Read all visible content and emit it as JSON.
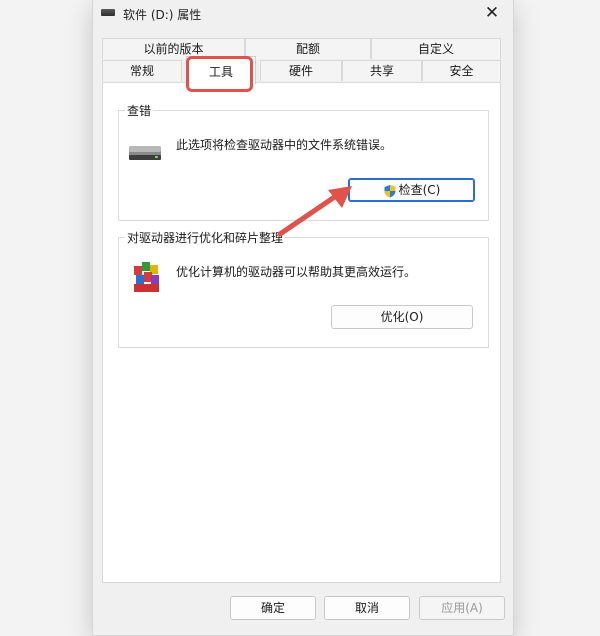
{
  "window": {
    "title": "软件 (D:) 属性"
  },
  "tabs": {
    "row1": [
      {
        "label": "以前的版本"
      },
      {
        "label": "配额"
      },
      {
        "label": "自定义"
      }
    ],
    "row2": [
      {
        "label": "常规"
      },
      {
        "label": "工具"
      },
      {
        "label": "硬件"
      },
      {
        "label": "共享"
      },
      {
        "label": "安全"
      }
    ]
  },
  "error_check": {
    "title": "查错",
    "description": "此选项将检查驱动器中的文件系统错误。",
    "button_label": "检查(C)"
  },
  "optimize": {
    "title": "对驱动器进行优化和碎片整理",
    "description": "优化计算机的驱动器可以帮助其更高效运行。",
    "button_label": "优化(O)"
  },
  "footer": {
    "ok": "确定",
    "cancel": "取消",
    "apply": "应用(A)"
  },
  "colors": {
    "highlight": "#e0524c",
    "accent": "#2c6fd1"
  },
  "icons": [
    "drive-icon",
    "close-icon",
    "uac-shield-icon",
    "defrag-icon",
    "arrow-annotation-icon"
  ]
}
